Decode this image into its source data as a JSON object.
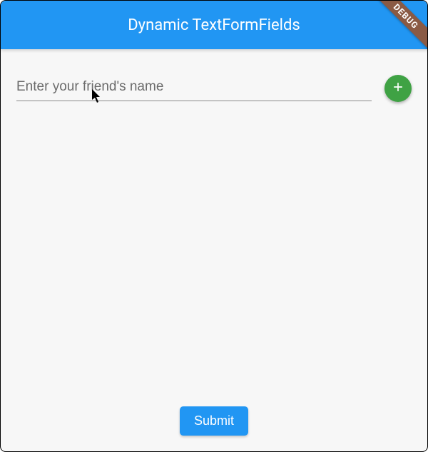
{
  "appbar": {
    "title": "Dynamic TextFormFields"
  },
  "debug_banner": "DEBUG",
  "form": {
    "fields": [
      {
        "placeholder": "Enter your friend's name",
        "value": ""
      }
    ],
    "submit_label": "Submit"
  }
}
